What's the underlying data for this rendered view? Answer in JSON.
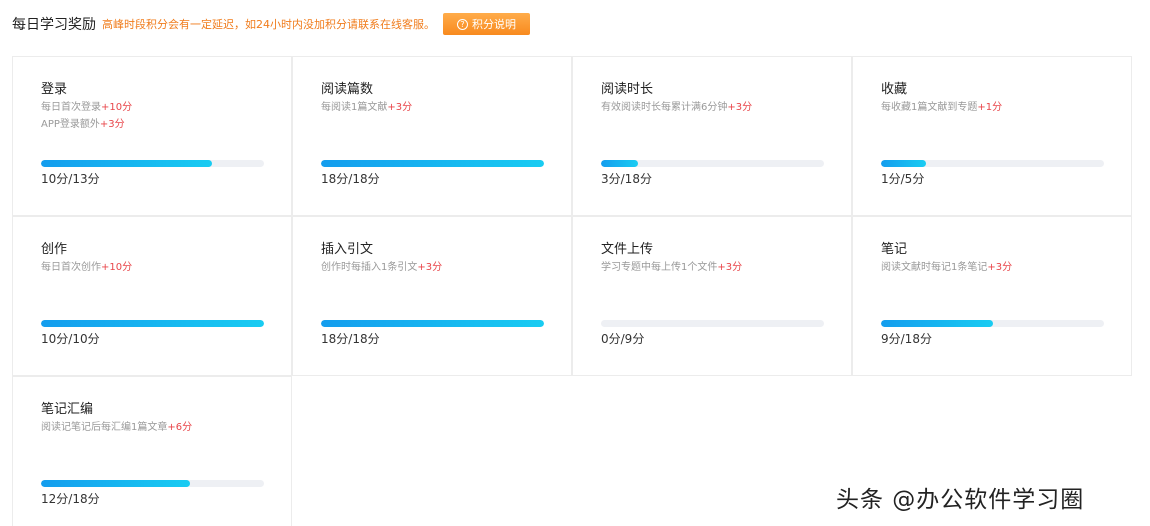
{
  "header": {
    "title": "每日学习奖励",
    "notice": "高峰时段积分会有一定延迟，如24小时内没加积分请联系在线客服。",
    "explain_button": "积分说明",
    "explain_icon": "question-circle-icon"
  },
  "colors": {
    "accent_orange": "#f88a1e",
    "bonus_red": "#e8464a",
    "progress_start": "#149dee",
    "progress_end": "#19ccf2",
    "track": "#eef0f4"
  },
  "tasks": [
    {
      "name": "登录",
      "desc": [
        {
          "text": "每日首次登录",
          "bonus": "+10分"
        },
        {
          "text": "APP登录额外",
          "bonus": "+3分"
        }
      ],
      "score": "10分/13分",
      "progress": 0.769
    },
    {
      "name": "阅读篇数",
      "desc": [
        {
          "text": "每阅读1篇文献",
          "bonus": "+3分"
        }
      ],
      "score": "18分/18分",
      "progress": 1.0
    },
    {
      "name": "阅读时长",
      "desc": [
        {
          "text": "有效阅读时长每累计满6分钟",
          "bonus": "+3分"
        }
      ],
      "score": "3分/18分",
      "progress": 0.167
    },
    {
      "name": "收藏",
      "desc": [
        {
          "text": "每收藏1篇文献到专题",
          "bonus": "+1分"
        }
      ],
      "score": "1分/5分",
      "progress": 0.2
    },
    {
      "name": "创作",
      "desc": [
        {
          "text": "每日首次创作",
          "bonus": "+10分"
        }
      ],
      "score": "10分/10分",
      "progress": 1.0
    },
    {
      "name": "插入引文",
      "desc": [
        {
          "text": "创作时每插入1条引文",
          "bonus": "+3分"
        }
      ],
      "score": "18分/18分",
      "progress": 1.0
    },
    {
      "name": "文件上传",
      "desc": [
        {
          "text": "学习专题中每上传1个文件",
          "bonus": "+3分"
        }
      ],
      "score": "0分/9分",
      "progress": 0.0
    },
    {
      "name": "笔记",
      "desc": [
        {
          "text": "阅读文献时每记1条笔记",
          "bonus": "+3分"
        }
      ],
      "score": "9分/18分",
      "progress": 0.5
    },
    {
      "name": "笔记汇编",
      "desc": [
        {
          "text": "阅读记笔记后每汇编1篇文章",
          "bonus": "+6分"
        }
      ],
      "score": "12分/18分",
      "progress": 0.667
    }
  ],
  "watermark": "头条 @办公软件学习圈"
}
